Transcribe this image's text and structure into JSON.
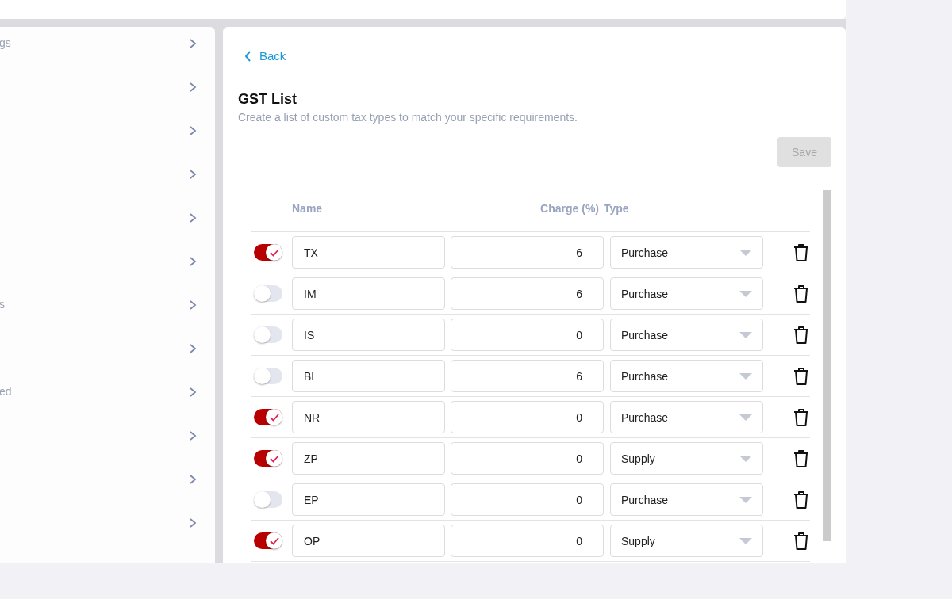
{
  "sidebar": {
    "items": [
      {
        "label": "gs",
        "expanded": false
      },
      {
        "expanded": false
      },
      {
        "expanded": false
      },
      {
        "expanded": false
      },
      {
        "expanded": false
      },
      {
        "expanded": false
      },
      {
        "label": "s",
        "expanded": false
      },
      {
        "expanded": false
      },
      {
        "label": "ed",
        "expanded": false
      },
      {
        "expanded": false
      },
      {
        "expanded": false
      },
      {
        "expanded": false
      }
    ]
  },
  "back_link": "Back",
  "title": "GST List",
  "subtitle": "Create a list of custom tax types to match your specific requirements.",
  "save_button": {
    "label": "Save",
    "disabled": true
  },
  "table": {
    "columns": [
      "Name",
      "Charge (%)",
      "Type"
    ],
    "rows": [
      {
        "on": true,
        "name": "TX",
        "charge": "6",
        "type": "Purchase"
      },
      {
        "on": false,
        "name": "IM",
        "charge": "6",
        "type": "Purchase"
      },
      {
        "on": false,
        "name": "IS",
        "charge": "0",
        "type": "Purchase"
      },
      {
        "on": false,
        "name": "BL",
        "charge": "6",
        "type": "Purchase"
      },
      {
        "on": true,
        "name": "NR",
        "charge": "0",
        "type": "Purchase"
      },
      {
        "on": true,
        "name": "ZP",
        "charge": "0",
        "type": "Supply"
      },
      {
        "on": false,
        "name": "EP",
        "charge": "0",
        "type": "Purchase"
      },
      {
        "on": true,
        "name": "OP",
        "charge": "0",
        "type": "Supply"
      }
    ]
  }
}
